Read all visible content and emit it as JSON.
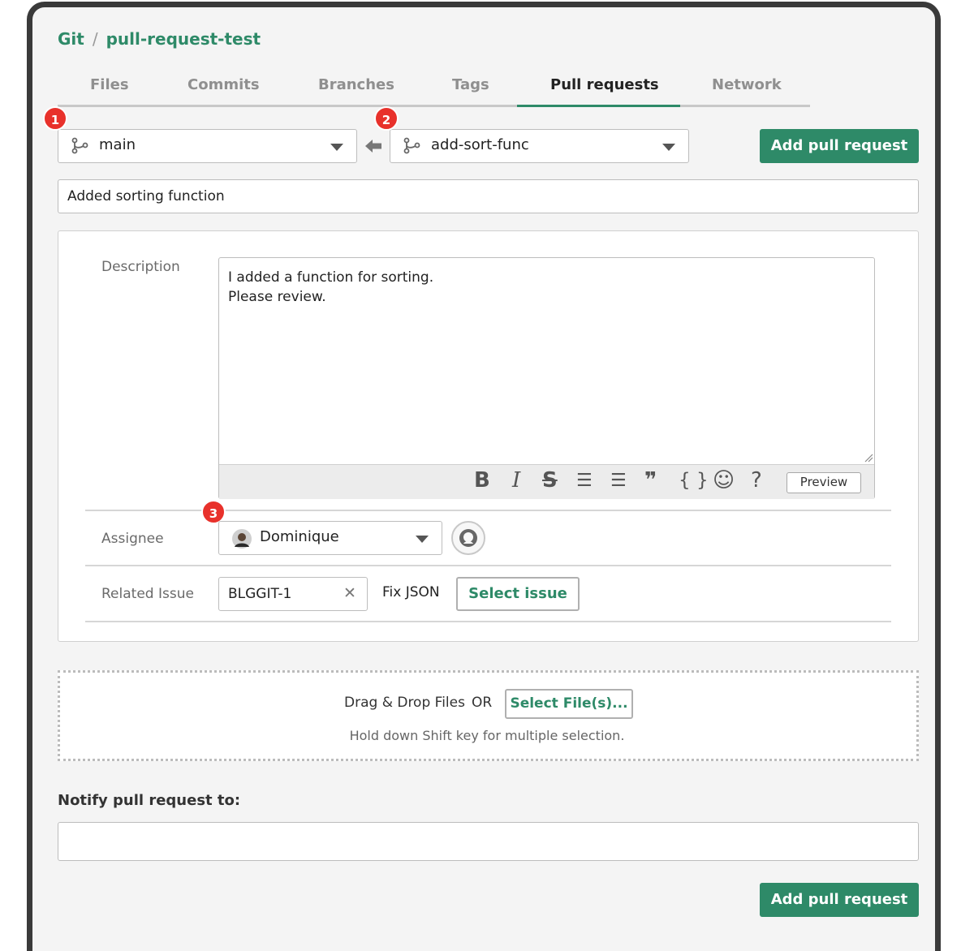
{
  "breadcrumb": {
    "root": "Git",
    "separator": "/",
    "repo": "pull-request-test"
  },
  "tabs": [
    {
      "label": "Files"
    },
    {
      "label": "Commits"
    },
    {
      "label": "Branches"
    },
    {
      "label": "Tags"
    },
    {
      "label": "Pull requests",
      "active": true
    },
    {
      "label": "Network"
    }
  ],
  "badges": {
    "one": "1",
    "two": "2",
    "three": "3"
  },
  "branches": {
    "target": "main",
    "source": "add-sort-func"
  },
  "buttons": {
    "add_pull_request": "Add pull request",
    "select_issue": "Select issue",
    "select_files": "Select File(s)...",
    "preview": "Preview"
  },
  "title_value": "Added sorting function",
  "description": {
    "label": "Description",
    "line1": "I added a function for sorting.",
    "line2": "Please review."
  },
  "toolbar": {
    "bold": "B",
    "italic": "I",
    "strike": "S",
    "bullets": "☰",
    "numbered": "☰",
    "quote": "❞",
    "code": "{ }",
    "emoji": "☺",
    "help": "?"
  },
  "assignee": {
    "label": "Assignee",
    "value": "Dominique"
  },
  "related_issue": {
    "label": "Related Issue",
    "value": "BLGGIT-1",
    "clear": "✕",
    "title": "Fix JSON"
  },
  "dropzone": {
    "drag_text": "Drag & Drop Files",
    "or": "OR",
    "hint": "Hold down Shift key for multiple selection."
  },
  "notify": {
    "label": "Notify pull request to:"
  },
  "colors": {
    "accent": "#2e8a68",
    "badge": "#e8312b"
  }
}
